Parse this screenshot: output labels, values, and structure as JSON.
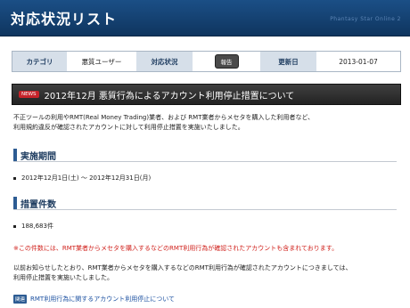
{
  "header": {
    "title": "対応状況リスト",
    "brand": "Phantasy Star Online 2"
  },
  "info": {
    "category_label": "カテゴリ",
    "category_value": "悪質ユーザー",
    "status_label": "対応状況",
    "status_value": "報告",
    "date_label": "更新日",
    "date_value": "2013-01-07"
  },
  "news": {
    "badge": "NEWS",
    "title": "2012年12月 悪質行為によるアカウント利用停止措置について"
  },
  "intro": {
    "line1": "不正ツールの利用やRMT(Real Money Trading)業者、および RMT業者からメセタを購入した利用者など、",
    "line2": "利用規約違反が確認されたアカウントに対して利用停止措置を実施いたしました。"
  },
  "period": {
    "heading": "実施期間",
    "value": "2012年12月1日(土) 〜 2012年12月31日(月)"
  },
  "count": {
    "heading": "措置件数",
    "value": "188,683件"
  },
  "note": "※この件数には、RMT業者からメセタを購入するなどのRMT利用行為が確認されたアカウントも含まれております。",
  "para2": {
    "line1": "以前お知らせしたとおり、RMT業者からメセタを購入するなどのRMT利用行為が確認されたアカウントにつきましては、",
    "line2": "利用停止措置を実施いたしました。"
  },
  "related": {
    "tag": "関連",
    "link": "RMT利用行為に関するアカウント利用停止について"
  }
}
